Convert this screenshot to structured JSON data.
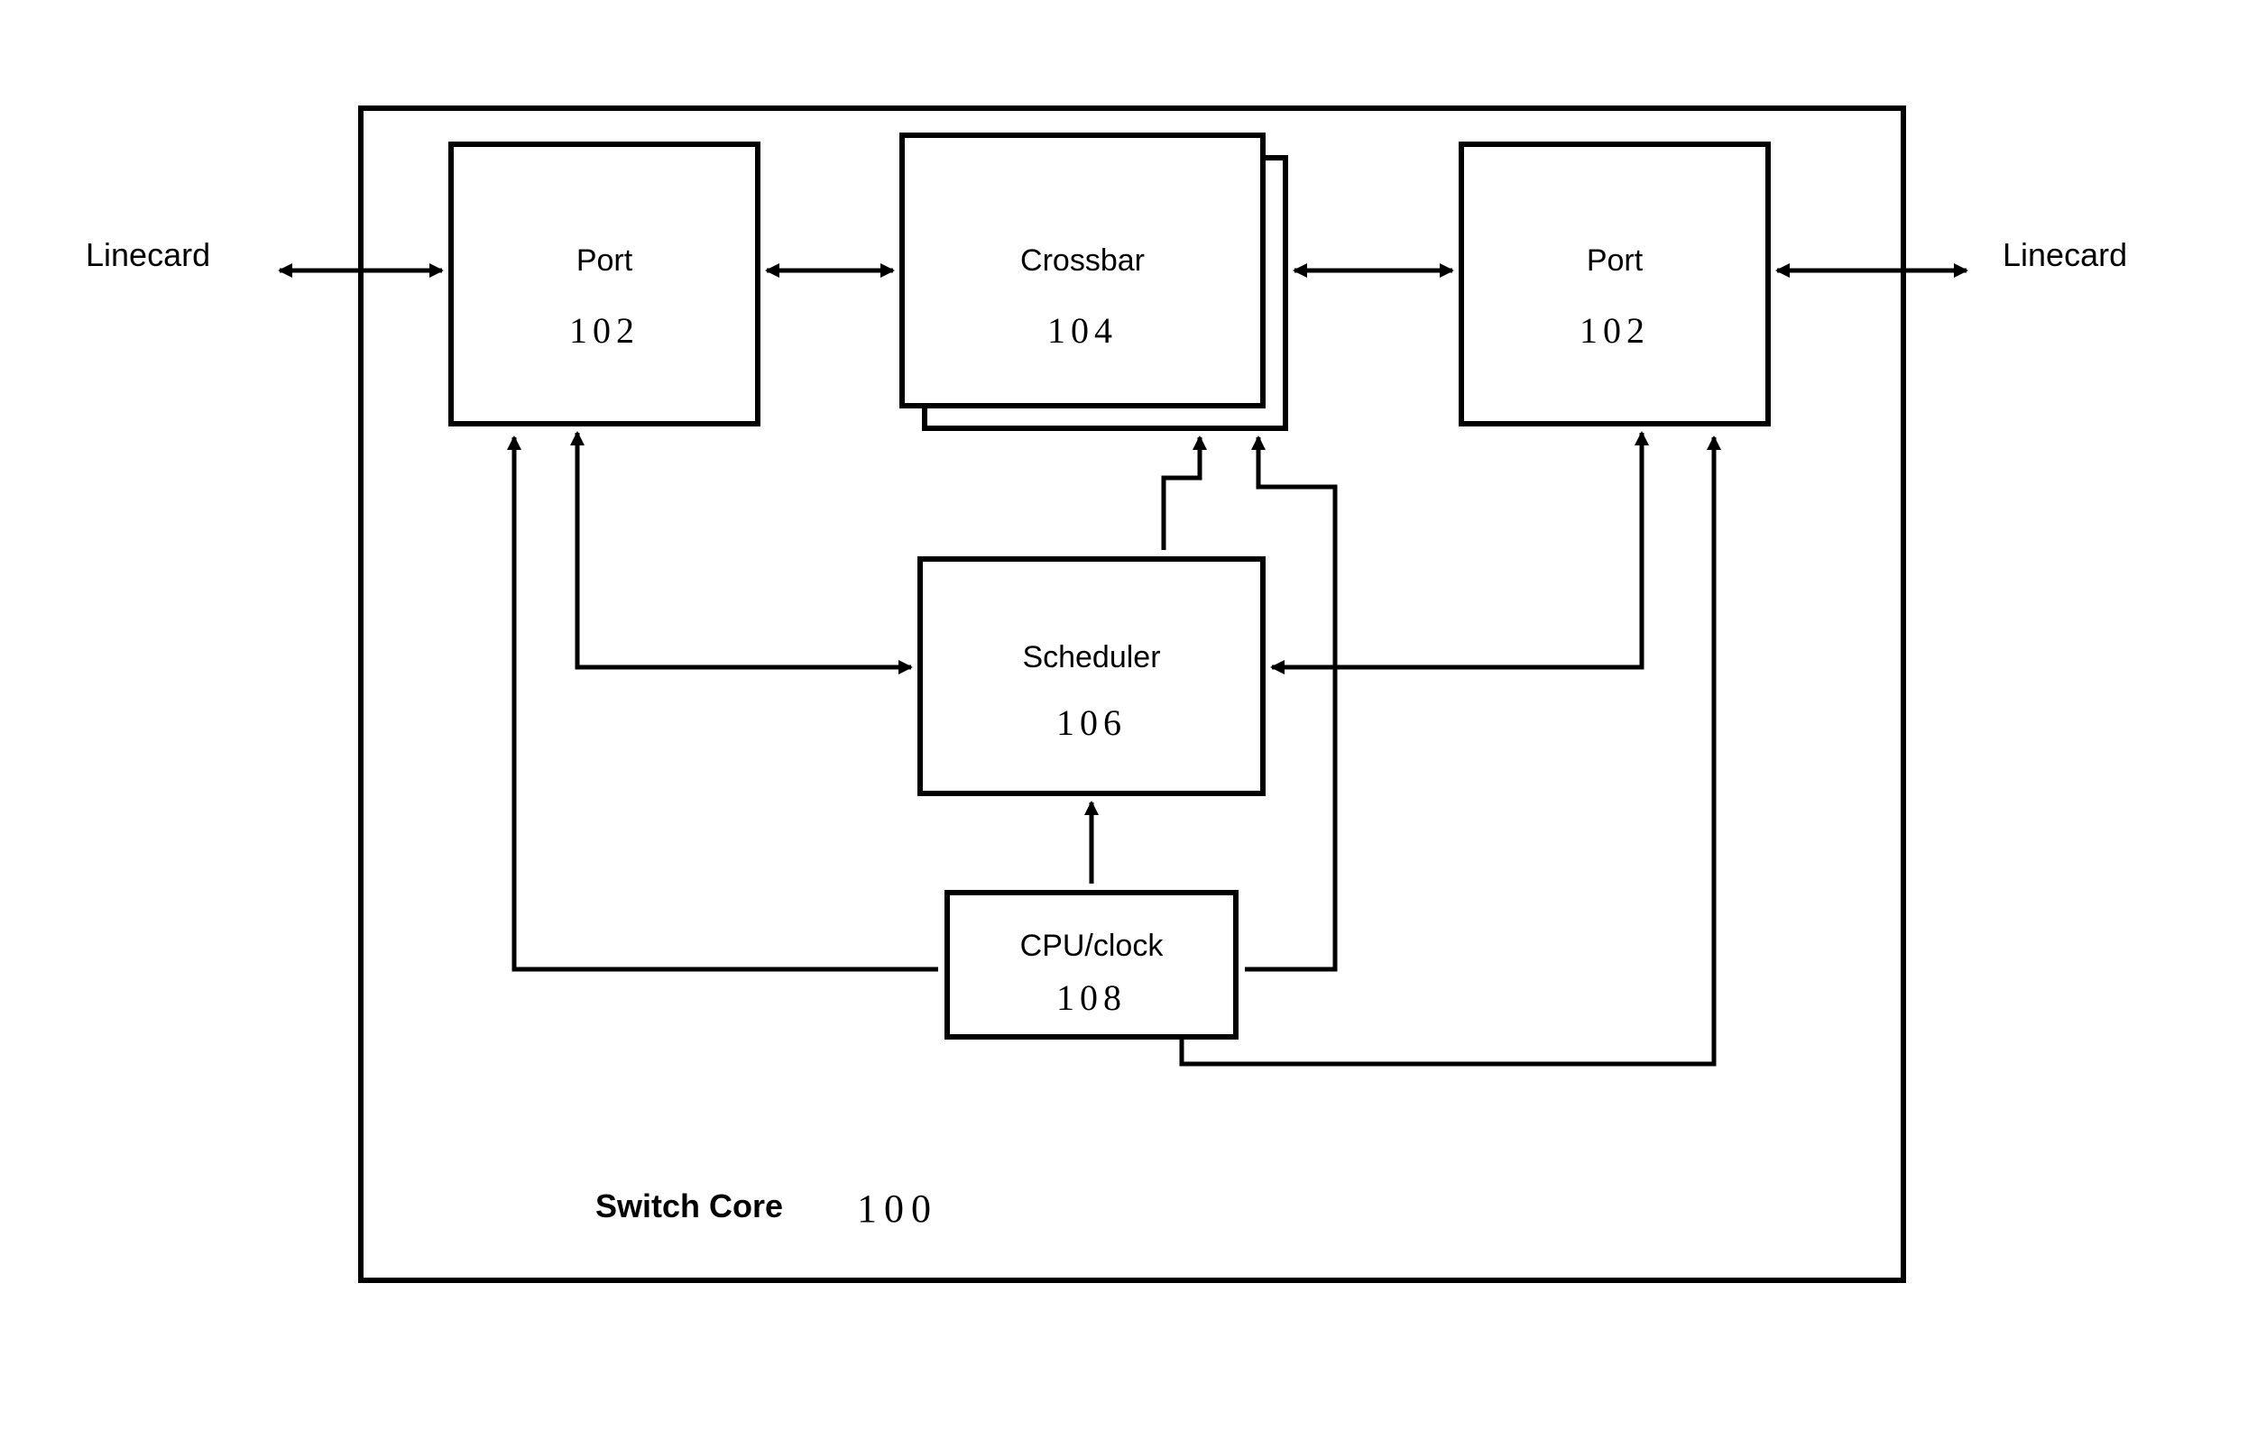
{
  "outside": {
    "linecard_left": "Linecard",
    "linecard_right": "Linecard"
  },
  "core": {
    "label": "Switch Core",
    "num": "100"
  },
  "blocks": {
    "port_left": {
      "label": "Port",
      "num": "102"
    },
    "crossbar": {
      "label": "Crossbar",
      "num": "104"
    },
    "port_right": {
      "label": "Port",
      "num": "102"
    },
    "scheduler": {
      "label": "Scheduler",
      "num": "106"
    },
    "cpu": {
      "label": "CPU/clock",
      "num": "108"
    }
  }
}
